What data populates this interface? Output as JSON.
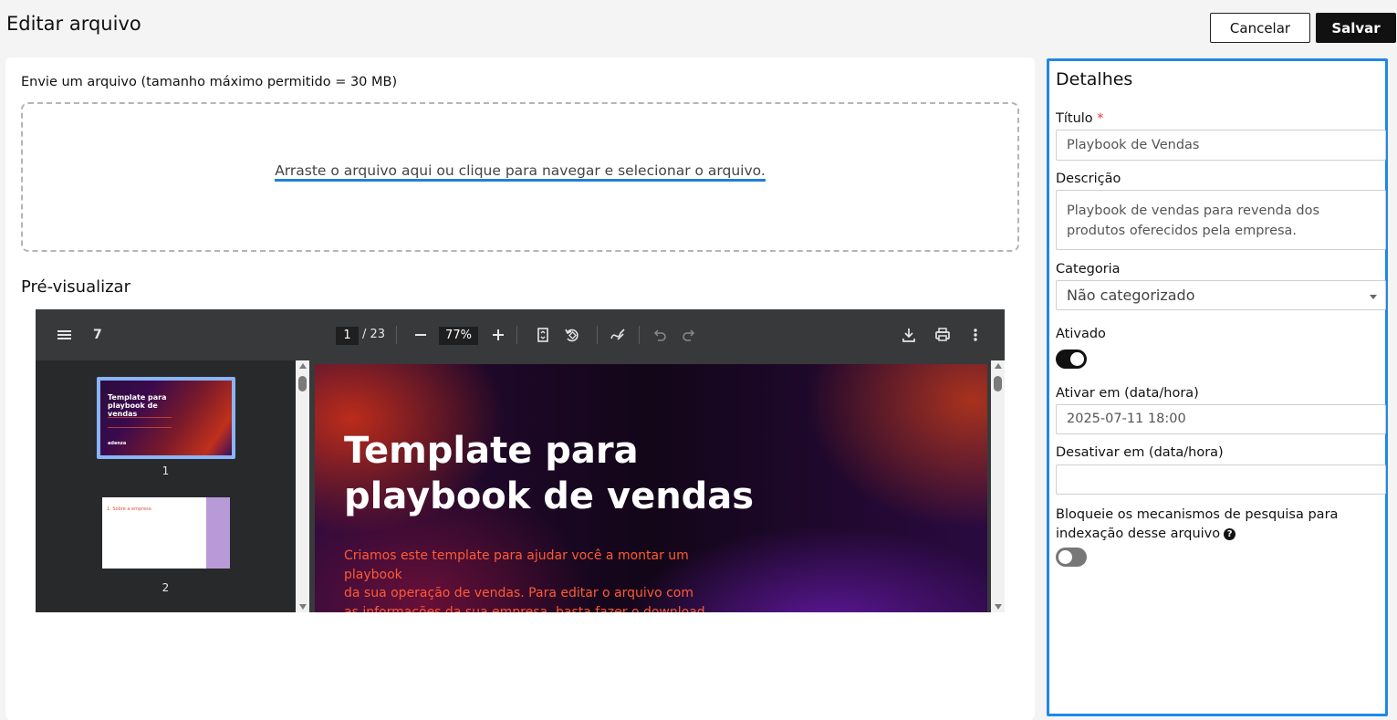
{
  "header": {
    "title": "Editar arquivo",
    "cancel_label": "Cancelar",
    "save_label": "Salvar"
  },
  "upload": {
    "label": "Envie um arquivo (tamanho máximo permitido = 30 MB)",
    "dropzone_text": "Arraste o arquivo aqui ou clique para navegar e selecionar o arquivo."
  },
  "preview": {
    "label": "Pré-visualizar",
    "viewer": {
      "thumbnail_count_label": "7",
      "current_page": "1",
      "total_pages": "/ 23",
      "zoom": "77%",
      "thumbnails": [
        {
          "number": "1",
          "title": "Template para playbook de vendas",
          "logo": "adenza"
        },
        {
          "number": "2",
          "title": "1. Sobre a empresa"
        }
      ],
      "slide": {
        "title_line1": "Template para",
        "title_line2": "playbook de vendas",
        "body_line1": "Criamos este template para ajudar você a montar um playbook",
        "body_line2": "da sua operação de vendas. Para editar o arquivo com",
        "body_line3": "as informações da sua empresa, basta fazer o download."
      },
      "icons": {
        "menu": "menu-icon",
        "zoom_out": "minus-icon",
        "zoom_in": "plus-icon",
        "fit_page": "fit-page-icon",
        "rotate": "rotate-icon",
        "annotate": "pen-icon",
        "undo": "undo-icon",
        "redo": "redo-icon",
        "download": "download-icon",
        "print": "print-icon",
        "more": "more-vertical-icon"
      }
    }
  },
  "details": {
    "title": "Detalhes",
    "titulo_label": "Título",
    "titulo_required": "*",
    "titulo_value": "Playbook de Vendas",
    "descricao_label": "Descrição",
    "descricao_value": "Playbook de vendas para revenda dos produtos oferecidos pela empresa.",
    "categoria_label": "Categoria",
    "categoria_value": "Não categorizado",
    "ativado_label": "Ativado",
    "ativado": true,
    "ativar_label": "Ativar em (data/hora)",
    "ativar_value": "2025-07-11 18:00",
    "desativar_label": "Desativar em (data/hora)",
    "desativar_value": "",
    "bloquear_label_line1": "Bloqueie os mecanismos de pesquisa para",
    "bloquear_label_line2": "indexação desse arquivo",
    "bloquear": false
  },
  "colors": {
    "accent": "#1f88e5",
    "primary_button": "#111111",
    "required": "#e53935"
  }
}
